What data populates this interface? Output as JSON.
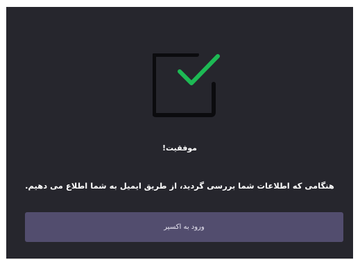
{
  "dialog": {
    "icon": "checkbox-check-icon",
    "colors": {
      "background": "#26262d",
      "check": "#1db954",
      "box": "#0b0b0e",
      "button": "#524d6e"
    },
    "title": "موفقیت!",
    "message": "هنگامی که اطلاعات شما بررسی گردید، از طریق ایمیل به شما اطلاع می دهیم.",
    "button_label": "ورود به اکسیر"
  }
}
